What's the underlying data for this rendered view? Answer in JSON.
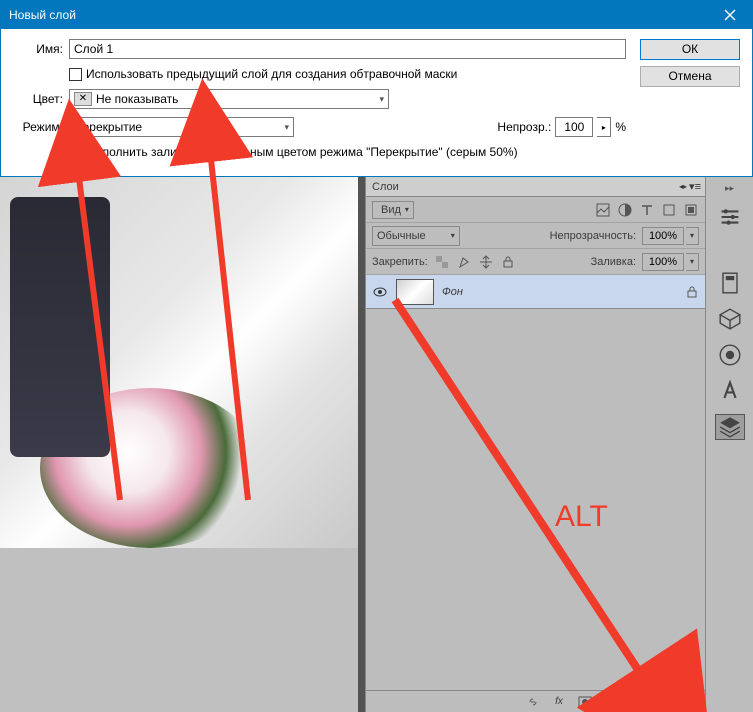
{
  "dialog": {
    "title": "Новый слой",
    "name_label": "Имя:",
    "name_value": "Слой 1",
    "clip_label": "Использовать предыдущий слой для создания обтравочной маски",
    "color_label": "Цвет:",
    "color_value": "Не показывать",
    "mode_label": "Режим:",
    "mode_value": "Перекрытие",
    "opacity_label": "Непрозр.:",
    "opacity_value": "100",
    "opacity_unit": "%",
    "fill_label": "Выполнить заливку нейтральным цветом режима \"Перекрытие\"  (серым 50%)",
    "ok": "ОК",
    "cancel": "Отмена"
  },
  "layers": {
    "tab": "Слои",
    "kind": "Вид",
    "blend": "Обычные",
    "opacity_label": "Непрозрачность:",
    "opacity_value": "100%",
    "lock_label": "Закрепить:",
    "fill_label": "Заливка:",
    "fill_value": "100%",
    "bg_layer": "Фон"
  },
  "annotation": {
    "alt": "ALT"
  }
}
